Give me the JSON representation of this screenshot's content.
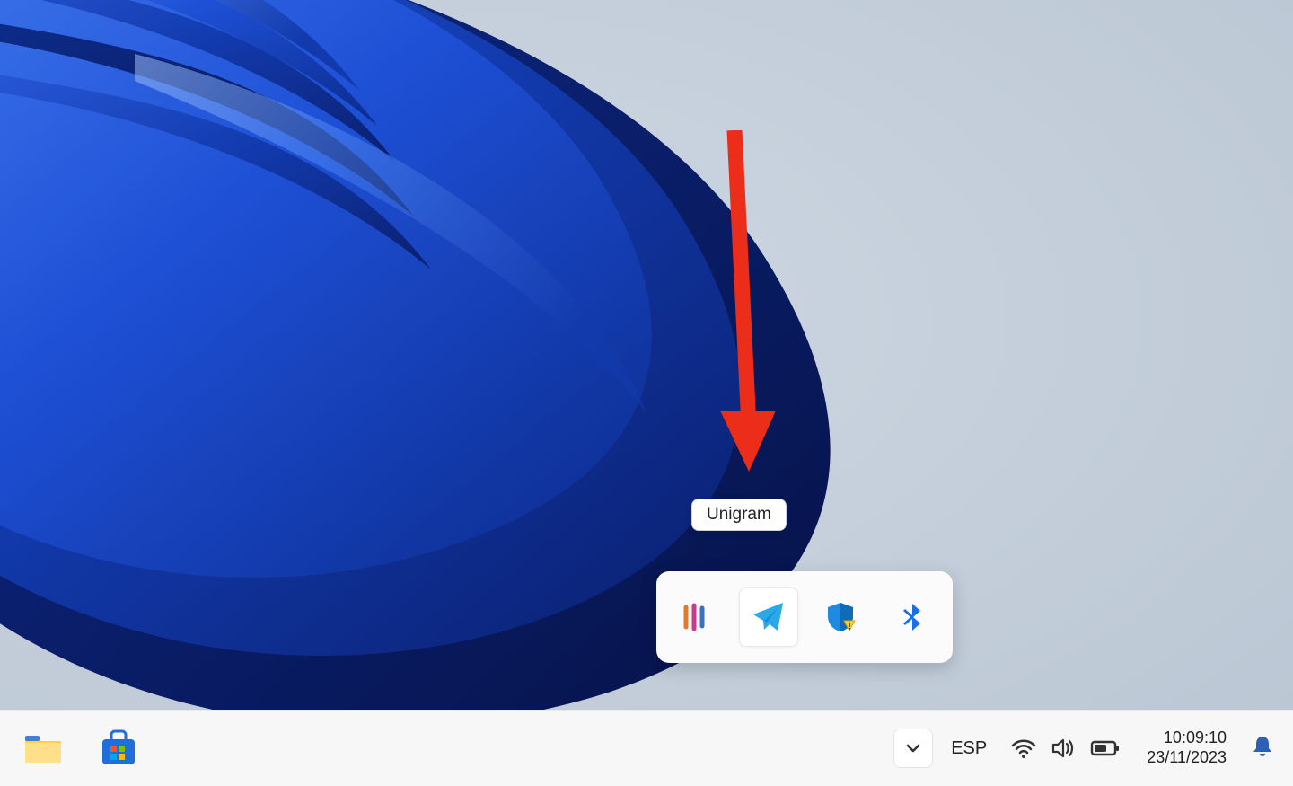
{
  "tooltip_label": "Unigram",
  "tray_flyout_items": [
    {
      "name": "app-generic",
      "selected": false
    },
    {
      "name": "unigram",
      "selected": true
    },
    {
      "name": "windows-security",
      "selected": false
    },
    {
      "name": "bluetooth",
      "selected": false
    }
  ],
  "taskbar": {
    "apps": [
      {
        "name": "file-explorer"
      },
      {
        "name": "microsoft-store"
      }
    ],
    "language": "ESP",
    "time": "10:09:10",
    "date": "23/11/2023"
  }
}
